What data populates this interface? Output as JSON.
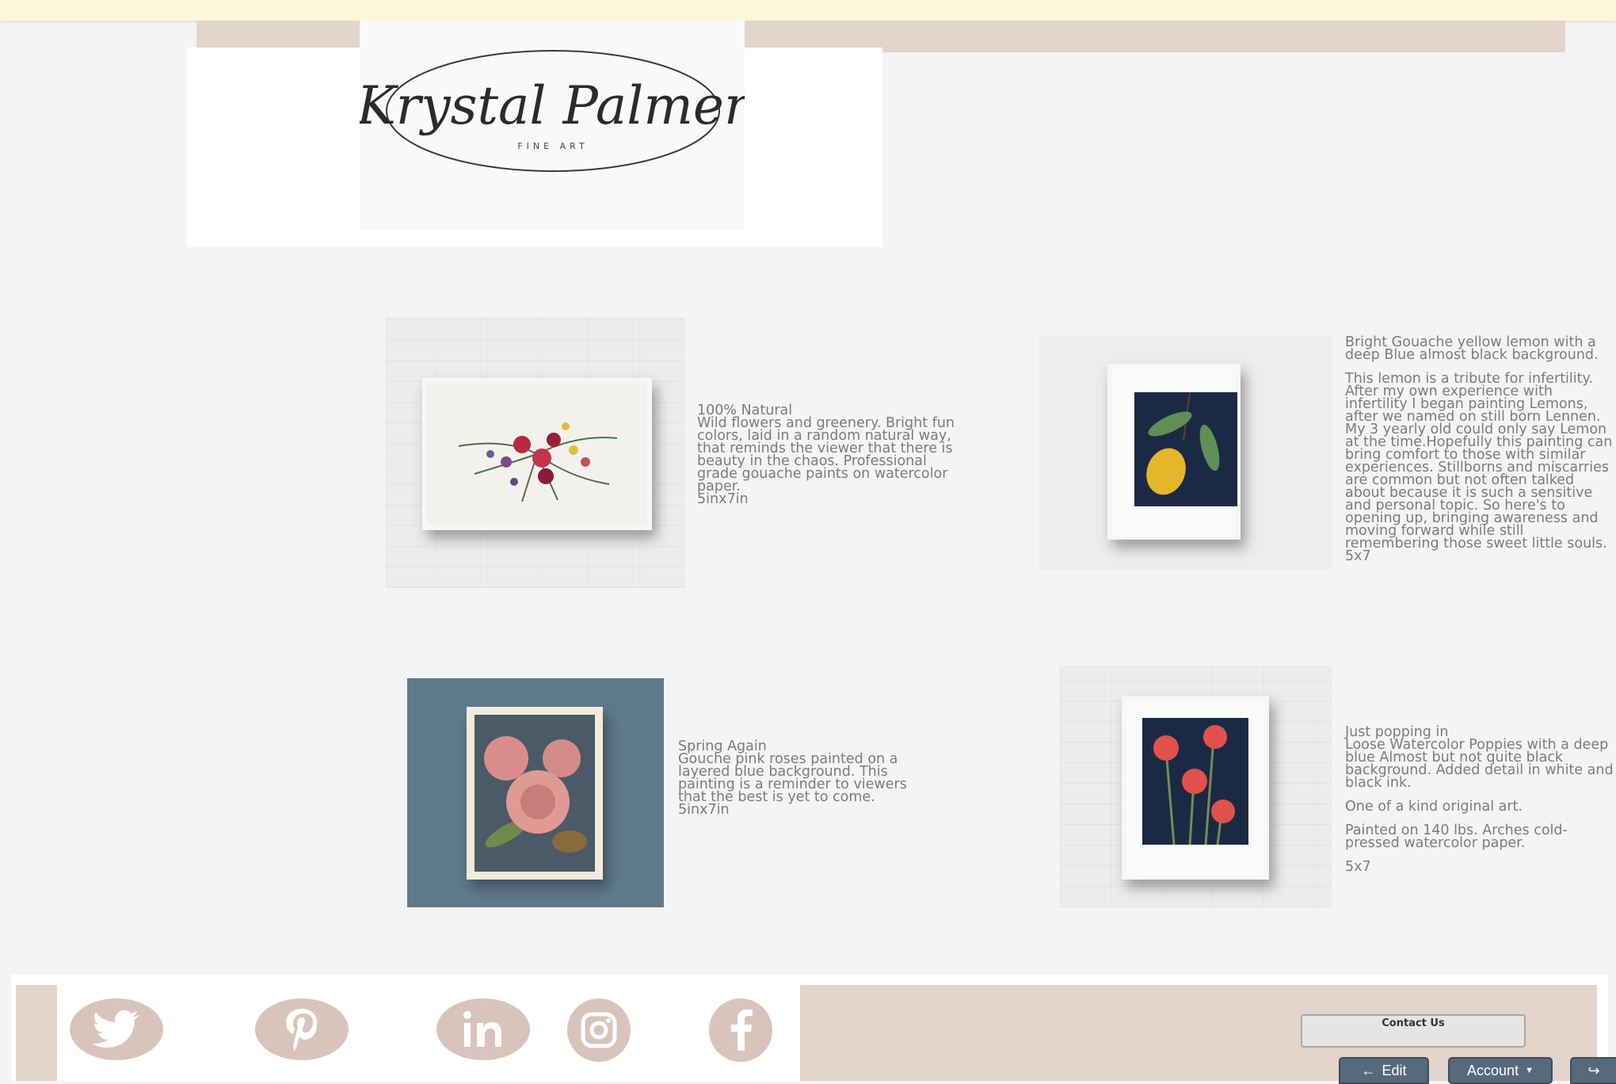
{
  "brand": {
    "name": "Krystal Palmer",
    "tagline": "FINE ART"
  },
  "artworks": [
    {
      "lines": [
        "100% Natural",
        "Wild flowers and greenery. Bright fun colors, laid in a random natural way, that reminds the viewer that there is beauty in the chaos. Professional grade gouache paints on watercolor paper.",
        "5inx7in"
      ]
    },
    {
      "lines": [
        "Bright Gouache yellow lemon with a deep Blue almost black background.",
        "This lemon is a tribute for infertility. After my own experience with infertility I began painting Lemons, after we named on still born Lennen. My 3 yearly old could only say Lemon at the time.Hopefully this painting can bring comfort to those with similar experiences. Stillborns and miscarries are common but not often talked about because it is such a sensitive and personal topic. So here's to opening up, bringing awareness and moving forward while still remembering those sweet little souls.",
        "5x7"
      ]
    },
    {
      "lines": [
        "Spring Again",
        "Gouche pink roses painted on a layered blue background. This painting is a reminder to viewers that the best is yet to come.",
        "5inx7in"
      ]
    },
    {
      "lines": [
        "Just popping in",
        "Loose Watercolor Poppies with a deep blue Almost but not quite black background. Added detail in white and black ink.",
        "One of a kind original art.",
        "Painted on 140 lbs. Arches cold-pressed watercolor paper.",
        "5x7"
      ]
    }
  ],
  "footer": {
    "social": [
      "twitter-icon",
      "pinterest-icon",
      "linkedin-icon",
      "instagram-icon",
      "facebook-icon"
    ],
    "contact_label": "Contact Us"
  },
  "admin_bar": {
    "edit_label": "Edit",
    "account_label": "Account"
  },
  "colors": {
    "accent": "#e3d5cb",
    "social": "#d9c4bb",
    "notice": "#fdf6d8",
    "admin": "#556a7a"
  }
}
